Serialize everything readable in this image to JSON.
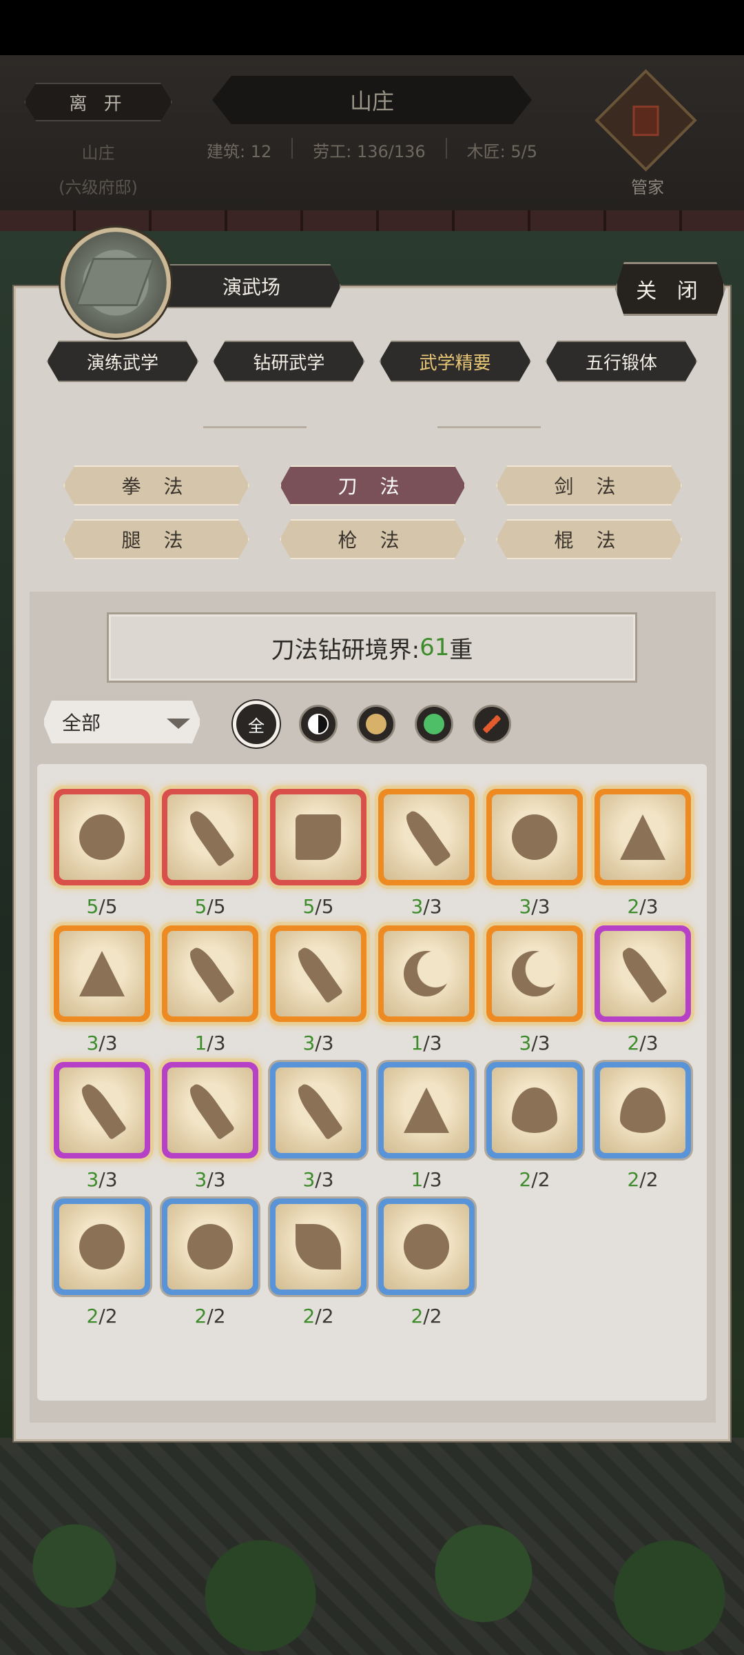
{
  "header": {
    "leave_label": "离 开",
    "estate_label": "山庄",
    "estate_level": "(六级府邸)",
    "title": "山庄",
    "stats": [
      "建筑: 12",
      "劳工: 136/136",
      "木匠: 5/5"
    ],
    "steward_label": "管家"
  },
  "panel": {
    "scene_title": "演武场",
    "close_label": "关 闭",
    "tabs": [
      {
        "label": "演练武学",
        "active": false
      },
      {
        "label": "钻研武学",
        "active": false
      },
      {
        "label": "武学精要",
        "active": true
      },
      {
        "label": "五行锻体",
        "active": false
      }
    ],
    "weapon_types": [
      {
        "label": "拳 法",
        "active": false
      },
      {
        "label": "刀 法",
        "active": true
      },
      {
        "label": "剑 法",
        "active": false
      },
      {
        "label": "腿 法",
        "active": false
      },
      {
        "label": "枪 法",
        "active": false
      },
      {
        "label": "棍 法",
        "active": false
      }
    ],
    "realm": {
      "prefix": "刀法钻研境界:",
      "value": "61",
      "suffix": "重"
    },
    "filter": {
      "selected": "全部",
      "icons": [
        {
          "icon": "all-filter-icon",
          "label": "全"
        },
        {
          "icon": "yin-yang-icon",
          "label": ""
        },
        {
          "icon": "ox-head-icon",
          "label": ""
        },
        {
          "icon": "boot-icon",
          "label": ""
        },
        {
          "icon": "blade-icon",
          "label": ""
        }
      ]
    }
  },
  "skills": [
    {
      "icon": "sword-arc-icon",
      "shape": "round",
      "tier": "red",
      "cur": "5",
      "max": "5"
    },
    {
      "icon": "demon-blade-icon",
      "shape": "blade",
      "tier": "red",
      "cur": "5",
      "max": "5"
    },
    {
      "icon": "cloud-boot-icon",
      "shape": "boot",
      "tier": "red",
      "cur": "5",
      "max": "5"
    },
    {
      "icon": "blade-wave-icon",
      "shape": "blade",
      "tier": "orange",
      "cur": "3",
      "max": "3"
    },
    {
      "icon": "comet-icon",
      "shape": "round",
      "tier": "orange",
      "cur": "3",
      "max": "3"
    },
    {
      "icon": "kneeling-warrior-icon",
      "shape": "tri",
      "tier": "orange",
      "cur": "2",
      "max": "3"
    },
    {
      "icon": "fighter-stance-icon",
      "shape": "tri",
      "tier": "orange",
      "cur": "3",
      "max": "3"
    },
    {
      "icon": "broad-blade-icon",
      "shape": "blade",
      "tier": "orange",
      "cur": "1",
      "max": "3"
    },
    {
      "icon": "scimitar-icon",
      "shape": "blade",
      "tier": "orange",
      "cur": "3",
      "max": "3"
    },
    {
      "icon": "crescent-moon-icon",
      "shape": "moon",
      "tier": "orange",
      "cur": "1",
      "max": "3"
    },
    {
      "icon": "half-moon-icon",
      "shape": "moon",
      "tier": "orange",
      "cur": "3",
      "max": "3"
    },
    {
      "icon": "spiral-blade-icon",
      "shape": "blade",
      "tier": "purple",
      "cur": "2",
      "max": "3"
    },
    {
      "icon": "long-blade-icon",
      "shape": "blade",
      "tier": "purple",
      "cur": "3",
      "max": "3"
    },
    {
      "icon": "dragon-blade-icon",
      "shape": "blade",
      "tier": "purple",
      "cur": "3",
      "max": "3"
    },
    {
      "icon": "staff-blade-icon",
      "shape": "blade",
      "tier": "blue",
      "cur": "3",
      "max": "3"
    },
    {
      "icon": "mountain-icon",
      "shape": "tri",
      "tier": "blue",
      "cur": "1",
      "max": "3"
    },
    {
      "icon": "flame-icon",
      "shape": "flame",
      "tier": "blue",
      "cur": "2",
      "max": "2"
    },
    {
      "icon": "fire-swirl-icon",
      "shape": "flame",
      "tier": "blue",
      "cur": "2",
      "max": "2"
    },
    {
      "icon": "cloud-icon",
      "shape": "round",
      "tier": "blue",
      "cur": "2",
      "max": "2"
    },
    {
      "icon": "tornado-icon",
      "shape": "round",
      "tier": "blue",
      "cur": "2",
      "max": "2"
    },
    {
      "icon": "leaves-icon",
      "shape": "leaf",
      "tier": "blue",
      "cur": "2",
      "max": "2"
    },
    {
      "icon": "dragon-head-icon",
      "shape": "round",
      "tier": "blue",
      "cur": "2",
      "max": "2"
    }
  ]
}
